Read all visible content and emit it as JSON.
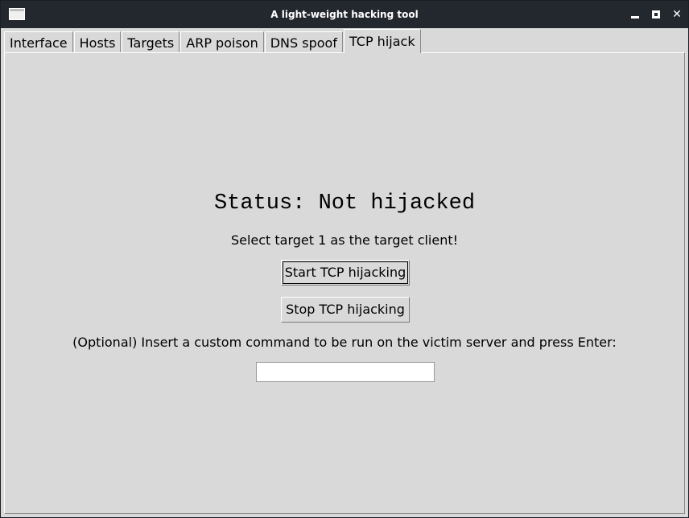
{
  "window": {
    "title": "A light-weight hacking tool",
    "close_glyph": "✕"
  },
  "tabs": [
    {
      "label": "Interface",
      "active": false
    },
    {
      "label": "Hosts",
      "active": false
    },
    {
      "label": "Targets",
      "active": false
    },
    {
      "label": "ARP poison",
      "active": false
    },
    {
      "label": "DNS spoof",
      "active": false
    },
    {
      "label": "TCP hijack",
      "active": true
    }
  ],
  "tcp_hijack": {
    "status_text": "Status: Not hijacked",
    "hint": "Select target 1 as the target client!",
    "start_label": "Start TCP hijacking",
    "stop_label": "Stop TCP hijacking",
    "optional_prompt": "(Optional) Insert a custom command to be run on the victim server and press Enter:",
    "command_value": ""
  },
  "colors": {
    "titlebar_bg": "#23272e",
    "window_bg": "#d9d9d9",
    "input_bg": "#ffffff"
  }
}
